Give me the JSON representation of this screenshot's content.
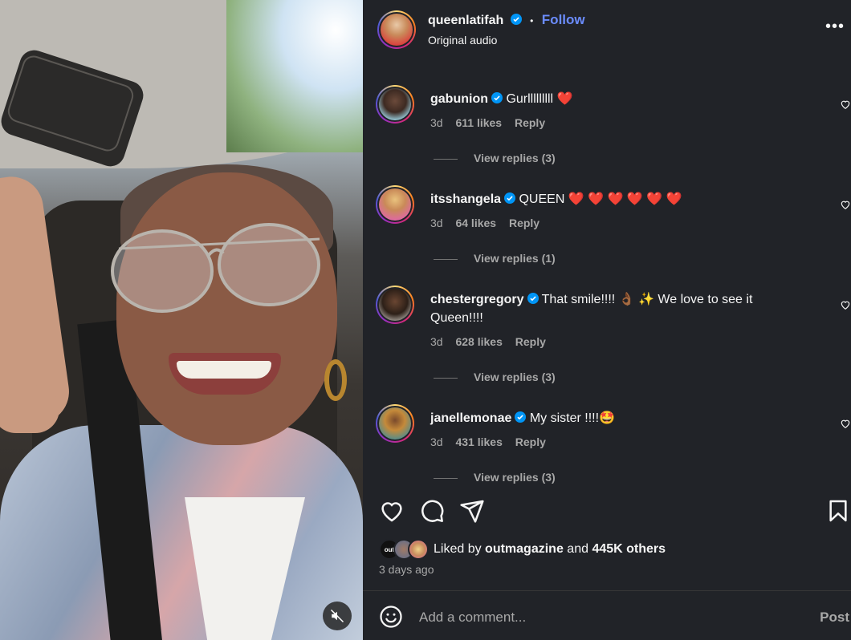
{
  "post": {
    "author": "queenlatifah",
    "follow_label": "Follow",
    "separator": "•",
    "audio": "Original audio",
    "more_label": "•••"
  },
  "comments": [
    {
      "user": "gabunion",
      "text": "Gurlllllllll ❤️",
      "age": "3d",
      "likes": "611 likes",
      "reply": "Reply",
      "replies": "View replies (3)"
    },
    {
      "user": "itsshangela",
      "text": "QUEEN ❤️ ❤️ ❤️ ❤️ ❤️ ❤️",
      "age": "3d",
      "likes": "64 likes",
      "reply": "Reply",
      "replies": "View replies (1)"
    },
    {
      "user": "chestergregory",
      "text": "That smile!!!! 👌🏾 ✨ We love to see it Queen!!!!",
      "age": "3d",
      "likes": "628 likes",
      "reply": "Reply",
      "replies": "View replies (3)"
    },
    {
      "user": "janellemonae",
      "text": "My sister !!!!🤩",
      "age": "3d",
      "likes": "431 likes",
      "reply": "Reply",
      "replies": "View replies (3)"
    }
  ],
  "liked": {
    "prefix": "Liked by",
    "user": "outmagazine",
    "conj": "and",
    "others": "445K others",
    "avatar_label": "out"
  },
  "time": "3 days ago",
  "composer": {
    "placeholder": "Add a comment...",
    "post_label": "Post"
  },
  "icons": [
    "heart-icon",
    "comment-icon",
    "share-icon",
    "bookmark-icon",
    "emoji-icon",
    "muted-icon",
    "verified-icon",
    "more-icon"
  ],
  "colors": {
    "follow": "#6b8cff",
    "panel": "#212328",
    "verified": "#0095f6"
  }
}
